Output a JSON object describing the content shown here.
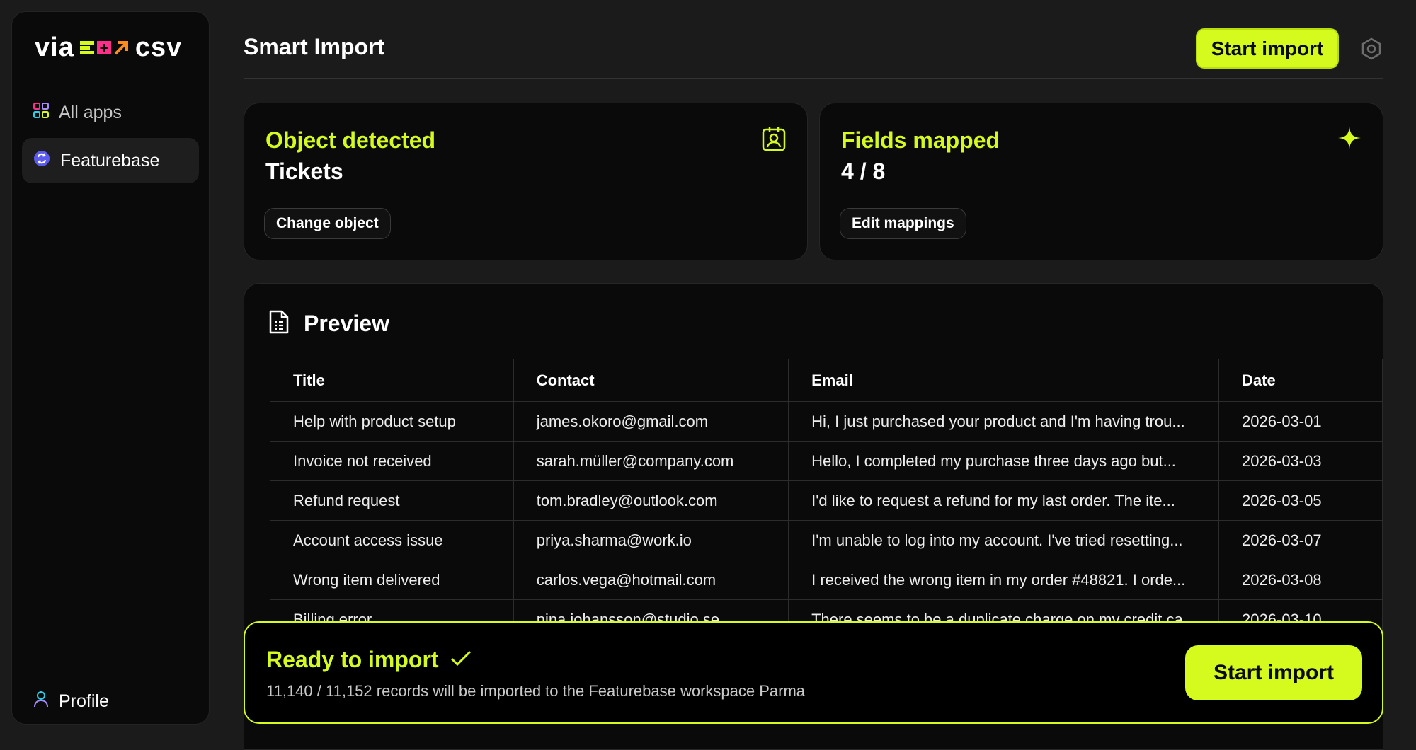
{
  "sidebar": {
    "logo": {
      "left": "via",
      "right": "csv"
    },
    "items": [
      {
        "label": "All apps",
        "icon": "grid-icon"
      },
      {
        "label": "Featurebase",
        "icon": "featurebase-logo-icon"
      }
    ],
    "profile_label": "Profile"
  },
  "header": {
    "title": "Smart Import",
    "start_import_label": "Start import"
  },
  "object_card": {
    "title": "Object detected",
    "value": "Tickets",
    "button_label": "Change object"
  },
  "fields_card": {
    "title": "Fields mapped",
    "value": "4 / 8",
    "button_label": "Edit mappings"
  },
  "preview": {
    "title": "Preview",
    "columns": [
      "Title",
      "Contact",
      "Email",
      "Date"
    ],
    "rows": [
      [
        "Help with product setup",
        "james.okoro@gmail.com",
        "Hi, I just purchased your product and I'm having trou...",
        "2026-03-01"
      ],
      [
        "Invoice not received",
        "sarah.müller@company.com",
        "Hello, I completed my purchase three days ago but...",
        "2026-03-03"
      ],
      [
        "Refund request",
        "tom.bradley@outlook.com",
        "I'd like to request a refund for my last order. The ite...",
        "2026-03-05"
      ],
      [
        "Account access issue",
        "priya.sharma@work.io",
        "I'm unable to log into my account. I've tried resetting...",
        "2026-03-07"
      ],
      [
        "Wrong item delivered",
        "carlos.vega@hotmail.com",
        "I received the wrong item in my order #48821. I orde...",
        "2026-03-08"
      ],
      [
        "Billing error",
        "nina.johansson@studio.se",
        "There seems to be a duplicate charge on my credit ca...",
        "2026-03-10"
      ]
    ]
  },
  "ready_banner": {
    "title": "Ready to import",
    "description": "11,140 / 11,152 records will be imported to the Featurebase workspace Parma",
    "button_label": "Start import"
  },
  "colors": {
    "accent": "#d4fa1e",
    "background": "#1b1b1b",
    "card": "#0a0a0a"
  }
}
